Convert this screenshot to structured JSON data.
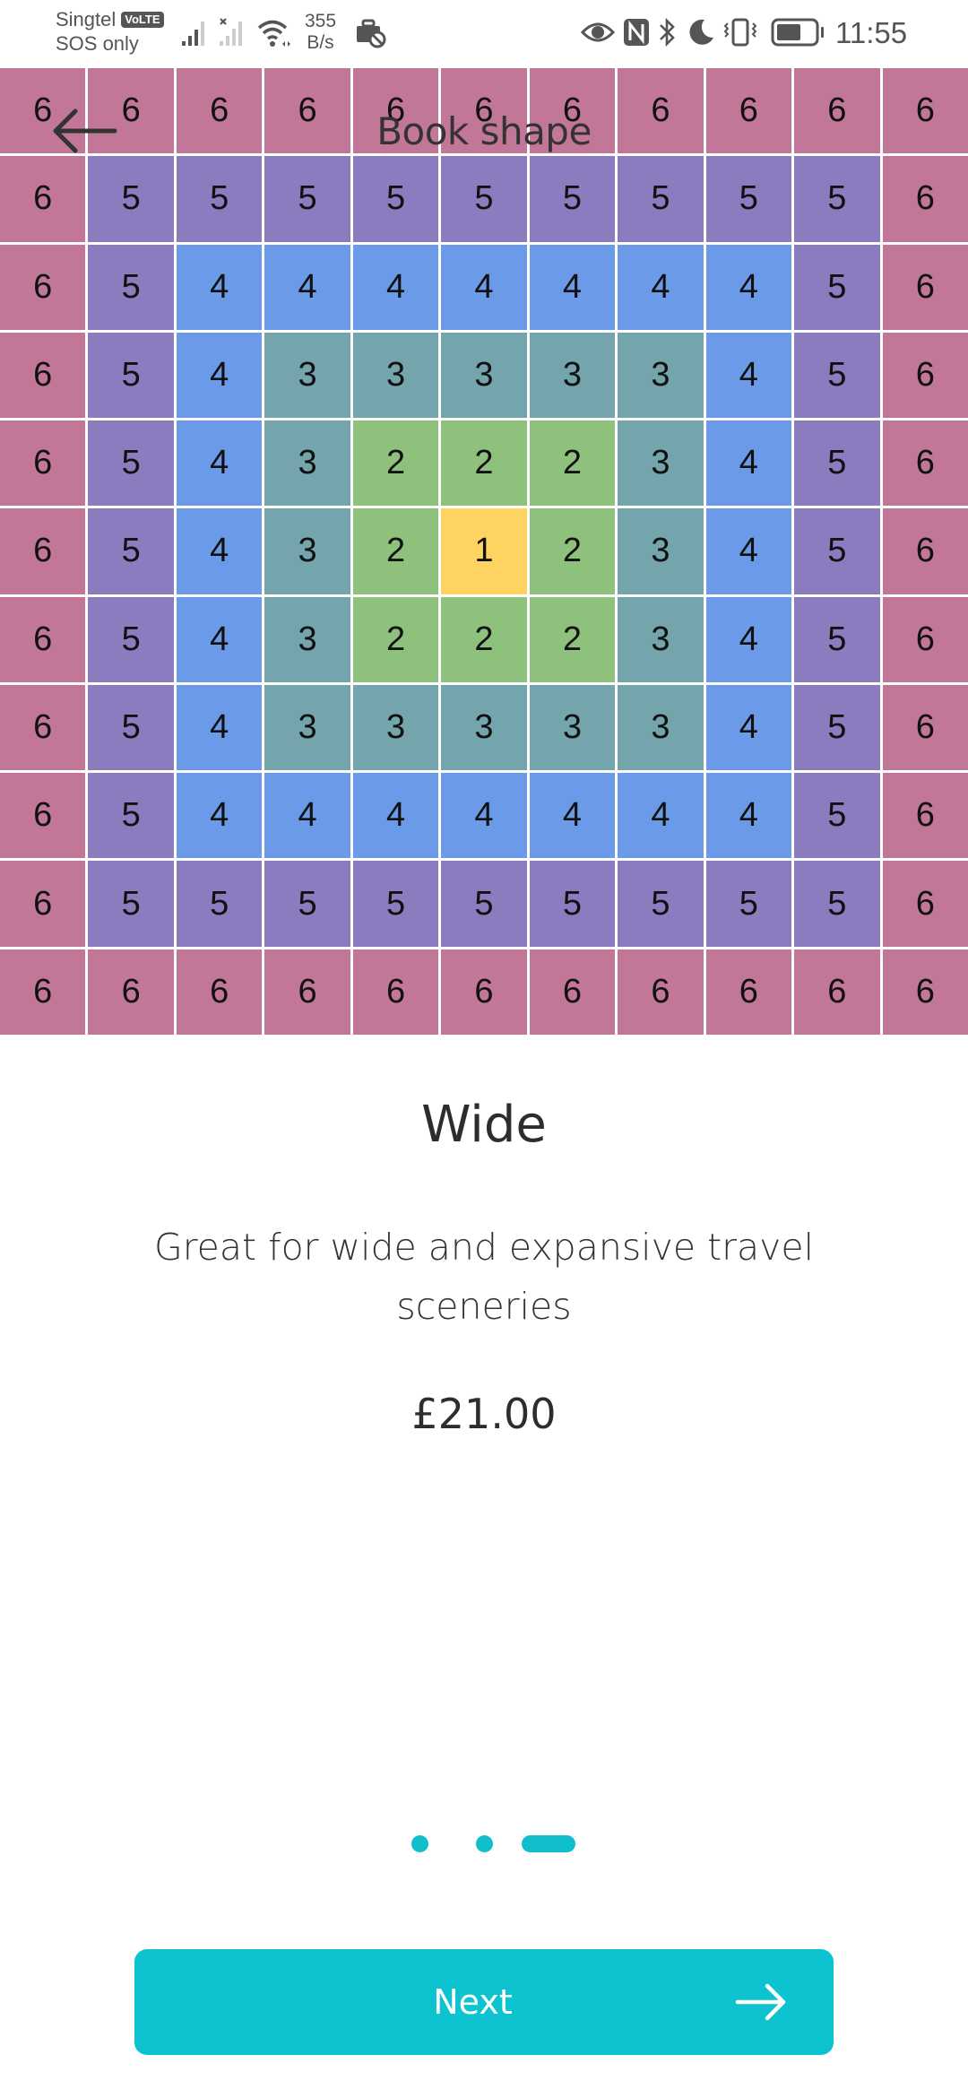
{
  "status_bar": {
    "carrier": "Singtel",
    "volte_badge": "VoLTE",
    "carrier_status": "SOS only",
    "net_speed_value": "355",
    "net_speed_unit": "B/s",
    "time": "11:55",
    "icons": [
      "signal-icon",
      "no-signal-icon",
      "wifi-icon",
      "briefcase-blocked-icon",
      "eye-icon",
      "nfc-icon",
      "bluetooth-icon",
      "moon-icon",
      "vibrate-icon",
      "battery-icon"
    ]
  },
  "header": {
    "title": "Book shape",
    "back_icon": "arrow-left-icon"
  },
  "grid": {
    "rows": [
      [
        6,
        6,
        6,
        6,
        6,
        6,
        6,
        6,
        6,
        6,
        6
      ],
      [
        6,
        5,
        5,
        5,
        5,
        5,
        5,
        5,
        5,
        5,
        6
      ],
      [
        6,
        5,
        4,
        4,
        4,
        4,
        4,
        4,
        4,
        5,
        6
      ],
      [
        6,
        5,
        4,
        3,
        3,
        3,
        3,
        3,
        4,
        5,
        6
      ],
      [
        6,
        5,
        4,
        3,
        2,
        2,
        2,
        3,
        4,
        5,
        6
      ],
      [
        6,
        5,
        4,
        3,
        2,
        1,
        2,
        3,
        4,
        5,
        6
      ],
      [
        6,
        5,
        4,
        3,
        2,
        2,
        2,
        3,
        4,
        5,
        6
      ],
      [
        6,
        5,
        4,
        3,
        3,
        3,
        3,
        3,
        4,
        5,
        6
      ],
      [
        6,
        5,
        4,
        4,
        4,
        4,
        4,
        4,
        4,
        5,
        6
      ],
      [
        6,
        5,
        5,
        5,
        5,
        5,
        5,
        5,
        5,
        5,
        6
      ],
      [
        6,
        6,
        6,
        6,
        6,
        6,
        6,
        6,
        6,
        6,
        6
      ]
    ],
    "colors": {
      "1": "#fdd462",
      "2": "#8ec27c",
      "3": "#74a4ac",
      "4": "#6b9be8",
      "5": "#8b7cc0",
      "6": "#c27799"
    }
  },
  "shape": {
    "name": "Wide",
    "description": "Great for wide and expansive travel sceneries",
    "price": "£21.00"
  },
  "pager": {
    "total": 3,
    "active_index": 2
  },
  "next_button": {
    "label": "Next",
    "icon": "arrow-right-icon"
  },
  "accent_color": "#0cc3cf"
}
